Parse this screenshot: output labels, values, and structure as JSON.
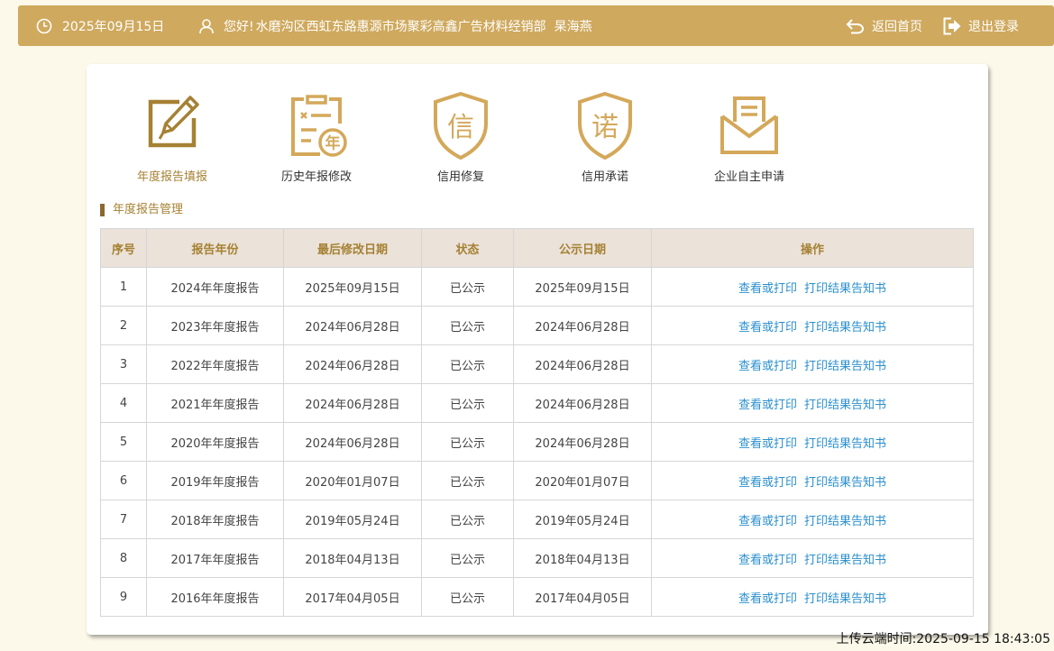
{
  "header": {
    "date": "2025年09月15日",
    "greeting": "您好!",
    "company": "水磨沟区西虹东路惠源市场聚彩高鑫广告材料经销部",
    "user": "杲海燕",
    "home_label": "返回首页",
    "logout_label": "退出登录",
    "colors": {
      "bar": "#cfa95e",
      "accent": "#a58133",
      "link": "#2a8fcf"
    }
  },
  "functions": [
    {
      "label": "年度报告填报",
      "icon": "edit-form-icon",
      "active": true
    },
    {
      "label": "历史年报修改",
      "icon": "clipboard-year-icon",
      "active": false
    },
    {
      "label": "信用修复",
      "icon": "shield-credit-icon",
      "active": false,
      "glyph": "信"
    },
    {
      "label": "信用承诺",
      "icon": "shield-promise-icon",
      "active": false,
      "glyph": "诺"
    },
    {
      "label": "企业自主申请",
      "icon": "envelope-icon",
      "active": false
    }
  ],
  "year_badge": "年",
  "section_title": "年度报告管理",
  "table": {
    "headers": [
      "序号",
      "报告年份",
      "最后修改日期",
      "状态",
      "公示日期",
      "操作"
    ],
    "action_view": "查看或打印",
    "action_print": "打印结果告知书",
    "rows": [
      {
        "no": "1",
        "year": "2024年年度报告",
        "modified": "2025年09月15日",
        "status": "已公示",
        "published": "2025年09月15日"
      },
      {
        "no": "2",
        "year": "2023年年度报告",
        "modified": "2024年06月28日",
        "status": "已公示",
        "published": "2024年06月28日"
      },
      {
        "no": "3",
        "year": "2022年年度报告",
        "modified": "2024年06月28日",
        "status": "已公示",
        "published": "2024年06月28日"
      },
      {
        "no": "4",
        "year": "2021年年度报告",
        "modified": "2024年06月28日",
        "status": "已公示",
        "published": "2024年06月28日"
      },
      {
        "no": "5",
        "year": "2020年年度报告",
        "modified": "2024年06月28日",
        "status": "已公示",
        "published": "2024年06月28日"
      },
      {
        "no": "6",
        "year": "2019年年度报告",
        "modified": "2020年01月07日",
        "status": "已公示",
        "published": "2020年01月07日"
      },
      {
        "no": "7",
        "year": "2018年年度报告",
        "modified": "2019年05月24日",
        "status": "已公示",
        "published": "2019年05月24日"
      },
      {
        "no": "8",
        "year": "2017年年度报告",
        "modified": "2018年04月13日",
        "status": "已公示",
        "published": "2018年04月13日"
      },
      {
        "no": "9",
        "year": "2016年年度报告",
        "modified": "2017年04月05日",
        "status": "已公示",
        "published": "2017年04月05日"
      }
    ]
  },
  "upload_time": "上传云端时间:2025-09-15 18:43:05"
}
